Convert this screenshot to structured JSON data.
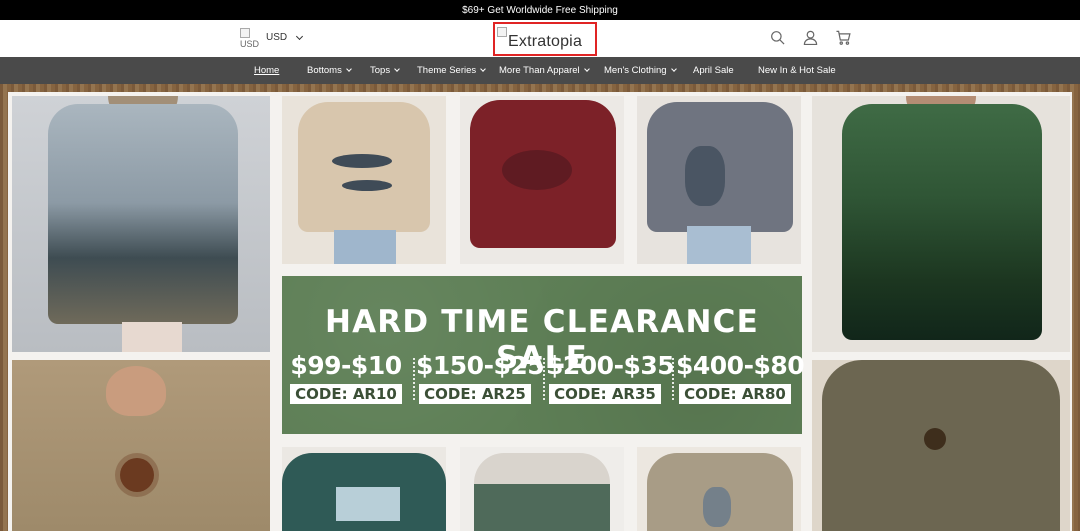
{
  "announcement": "$69+ Get Worldwide Free Shipping",
  "header": {
    "currency_flag_alt": "USD",
    "currency": "USD",
    "logo_alt": "Extratopia",
    "icons": [
      "search-icon",
      "account-icon",
      "cart-icon"
    ]
  },
  "nav": {
    "items": [
      {
        "label": "Home",
        "active": true,
        "dropdown": false
      },
      {
        "label": "Bottoms",
        "dropdown": true
      },
      {
        "label": "Tops",
        "dropdown": true
      },
      {
        "label": "Theme Series",
        "dropdown": true
      },
      {
        "label": "More Than Apparel",
        "dropdown": true
      },
      {
        "label": "Men's Clothing",
        "dropdown": true
      },
      {
        "label": "April Sale",
        "dropdown": false
      },
      {
        "label": "New In & Hot Sale",
        "dropdown": false
      }
    ]
  },
  "banner": {
    "title": "HARD TIME CLEARANCE SALE",
    "deals": [
      {
        "amount": "$99-$10",
        "code": "CODE: AR10"
      },
      {
        "amount": "$150-$25",
        "code": "CODE: AR25"
      },
      {
        "amount": "$200-$35",
        "code": "CODE: AR35"
      },
      {
        "amount": "$400-$80",
        "code": "CODE: AR80"
      }
    ]
  },
  "colors": {
    "topbar": "#000000",
    "nav": "#4a4a4a",
    "banner": "#5e7f56",
    "frame_wood": "#8a6a47",
    "logo_highlight": "#e02424"
  }
}
